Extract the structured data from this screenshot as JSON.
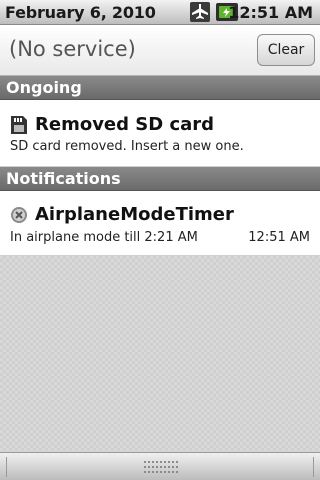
{
  "status_bar": {
    "date": "February 6, 2010",
    "time": "12:51 AM",
    "icons": [
      "airplane-mode-icon",
      "battery-charging-icon"
    ]
  },
  "carrier_header": {
    "label": "(No service)",
    "clear_label": "Clear"
  },
  "sections": {
    "ongoing": "Ongoing",
    "notifications": "Notifications"
  },
  "ongoing_items": [
    {
      "icon": "sd-card-icon",
      "title": "Removed SD card",
      "text": "SD card removed. Insert a new one."
    }
  ],
  "notification_items": [
    {
      "icon": "airplane-mode-timer-icon",
      "title": "AirplaneModeTimer",
      "text": "In airplane mode till 2:21 AM",
      "time": "12:51 AM"
    }
  ],
  "colors": {
    "section_header": "#7a7a7a",
    "battery_accent": "#5fb32d"
  }
}
